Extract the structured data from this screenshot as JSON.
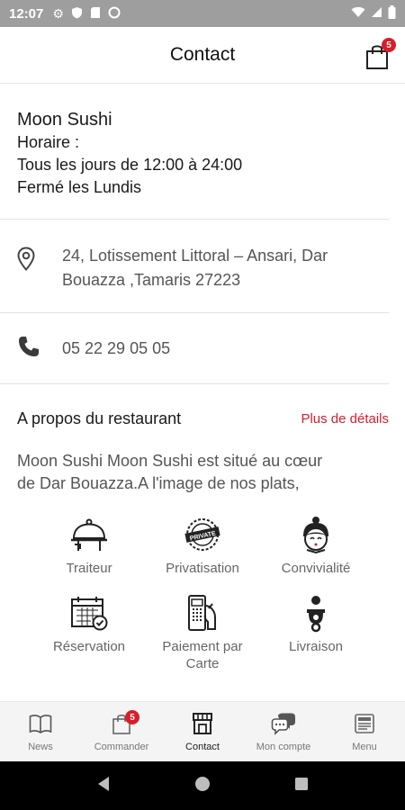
{
  "status_bar": {
    "time": "12:07"
  },
  "header": {
    "title": "Contact",
    "cart_badge": "5"
  },
  "restaurant": {
    "name": "Moon Sushi",
    "hours_label": "Horaire :",
    "hours": "Tous les jours de 12:00 à 24:00",
    "closed": "Fermé les Lundis"
  },
  "address": {
    "line1": "24, Lotissement Littoral – Ansari, Dar",
    "line2": "Bouazza ,Tamaris 27223"
  },
  "phone": {
    "number": "05 22 29 05 05"
  },
  "about": {
    "title": "A propos du restaurant",
    "link": "Plus de détails",
    "text_line1": "Moon Sushi Moon Sushi est situé au cœur",
    "text_line2": "de Dar Bouazza.A l'image de nos plats,"
  },
  "features": [
    {
      "label": "Traiteur",
      "icon": "cloche-icon"
    },
    {
      "label": "Privatisation",
      "icon": "private-stamp-icon"
    },
    {
      "label": "Convivialité",
      "icon": "geisha-icon"
    },
    {
      "label": "Réservation",
      "icon": "calendar-check-icon"
    },
    {
      "label": "Paiement par Carte",
      "icon": "card-terminal-icon"
    },
    {
      "label": "Livraison",
      "icon": "scooter-icon"
    }
  ],
  "bottom_nav": [
    {
      "label": "News",
      "icon": "book-icon"
    },
    {
      "label": "Commander",
      "icon": "bag-icon",
      "badge": "5"
    },
    {
      "label": "Contact",
      "icon": "store-icon"
    },
    {
      "label": "Mon compte",
      "icon": "chat-icon"
    },
    {
      "label": "Menu",
      "icon": "menu-card-icon"
    }
  ],
  "colors": {
    "accent": "#d21f2b",
    "badge": "#d81e2a",
    "status_bar": "#9e9e9e"
  }
}
